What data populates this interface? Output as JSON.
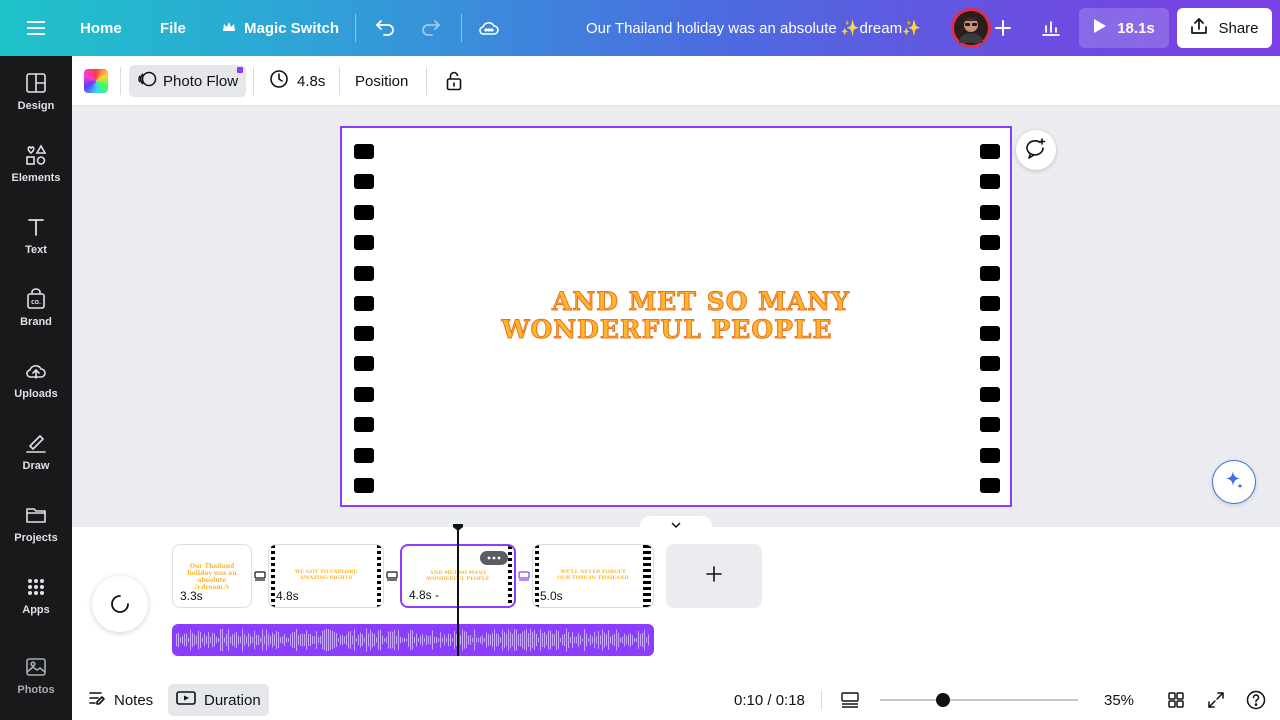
{
  "topbar": {
    "home": "Home",
    "file": "File",
    "magic_switch": "Magic Switch",
    "title": "Our Thailand holiday was an absolute ✨dream✨",
    "play_duration": "18.1s",
    "share": "Share"
  },
  "sidebar": {
    "items": [
      {
        "label": "Design",
        "icon": "design-icon"
      },
      {
        "label": "Elements",
        "icon": "elements-icon"
      },
      {
        "label": "Text",
        "icon": "text-icon"
      },
      {
        "label": "Brand",
        "icon": "brand-icon"
      },
      {
        "label": "Uploads",
        "icon": "uploads-icon"
      },
      {
        "label": "Draw",
        "icon": "draw-icon"
      },
      {
        "label": "Projects",
        "icon": "projects-icon"
      },
      {
        "label": "Apps",
        "icon": "apps-icon"
      },
      {
        "label": "Photos",
        "icon": "photos-icon"
      }
    ]
  },
  "toolbar": {
    "photo_flow": "Photo Flow",
    "duration": "4.8s",
    "position": "Position"
  },
  "canvas": {
    "line1": "AND MET SO MANY",
    "line2": "WONDERFUL PEOPLE"
  },
  "timeline": {
    "clips": [
      {
        "duration": "3.3s",
        "preview": "Our Thailand holiday was an absolute ✨dream✨"
      },
      {
        "duration": "4.8s",
        "preview": "WE GOT TO EXPLORE AMAZING SIGHTS"
      },
      {
        "duration": "4.8s",
        "preview": "AND MET SO MANY WONDERFUL PEOPLE"
      },
      {
        "duration": "5.0s",
        "preview": "WE'LL NEVER FORGET OUR TIME IN THAILAND"
      }
    ],
    "active_clip_index": 2
  },
  "footer": {
    "notes": "Notes",
    "duration": "Duration",
    "time": "0:10 / 0:18",
    "zoom": "35%",
    "zoom_level": 0.32
  },
  "colors": {
    "accent": "#8b3dff",
    "headline_fill": "#ffb52e",
    "headline_stroke": "#e8731e",
    "sidebar_bg": "#18191b"
  }
}
